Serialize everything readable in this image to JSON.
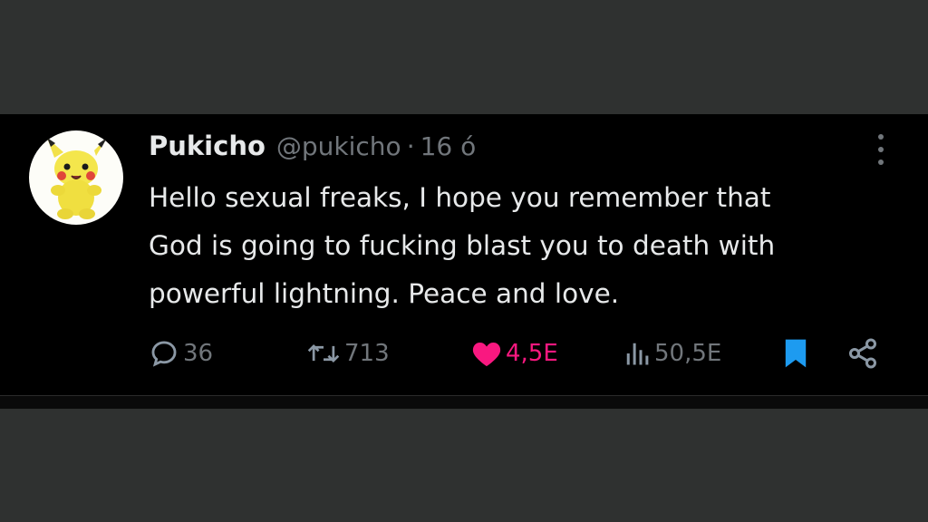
{
  "tweet": {
    "author_name": "Pukicho",
    "handle": "@pukicho",
    "separator": "·",
    "timestamp": "16 ó",
    "text_lines": [
      "Hello sexual freaks, I hope you remember that",
      "God is going to fucking blast you to death with",
      "powerful lightning. Peace and love."
    ],
    "avatar_icon": "pikachu-plush-avatar",
    "more_icon": "more-vertical-icon"
  },
  "actions": {
    "replies": {
      "icon": "reply-icon",
      "count": "36"
    },
    "retweets": {
      "icon": "retweet-icon",
      "count": "713"
    },
    "likes": {
      "icon": "heart-filled-icon",
      "count": "4,5E",
      "color": "#f91880"
    },
    "views": {
      "icon": "views-icon",
      "count": "50,5E"
    },
    "bookmark": {
      "icon": "bookmark-filled-icon",
      "color": "#1d9bf0"
    },
    "share": {
      "icon": "share-icon"
    }
  },
  "colors": {
    "background": "#2f3130",
    "tweet_background": "#000000",
    "primary_text": "#e7e9ea",
    "secondary_text": "#71767b"
  }
}
